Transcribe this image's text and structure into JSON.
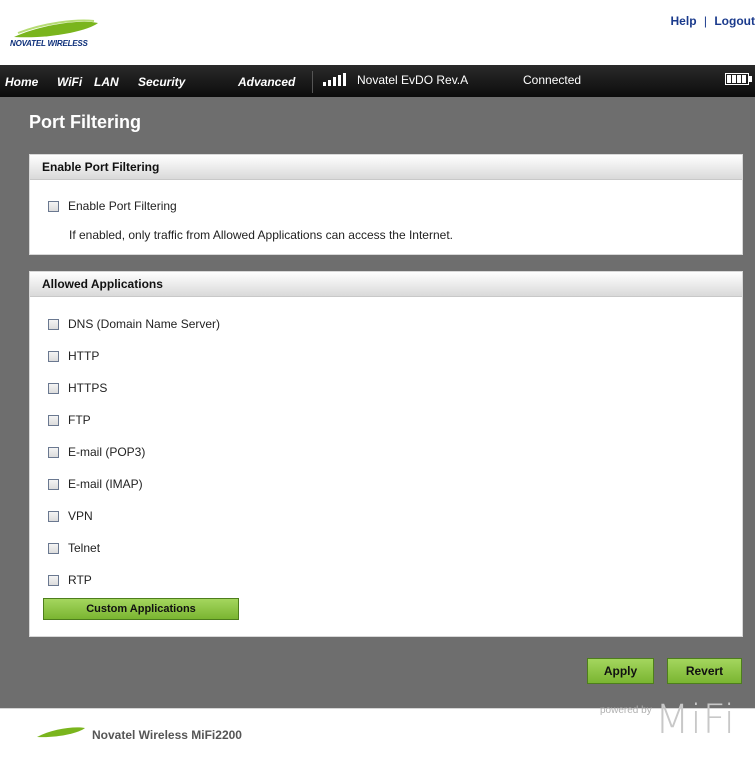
{
  "header": {
    "logo_text": "NOVATEL WIRELESS",
    "help_label": "Help",
    "separator": "|",
    "logout_label": "Logout"
  },
  "nav": {
    "tabs": [
      "Home",
      "WiFi",
      "LAN",
      "Security",
      "Advanced"
    ],
    "carrier": "Novatel EvDO Rev.A",
    "connection_status": "Connected",
    "signal_bars": 5,
    "battery_level": 1.0
  },
  "page": {
    "title": "Port Filtering"
  },
  "enable_section": {
    "heading": "Enable Port Filtering",
    "checkbox_label": "Enable Port Filtering",
    "checked": false,
    "note": "If enabled, only traffic from Allowed Applications can access the Internet."
  },
  "allowed_section": {
    "heading": "Allowed Applications",
    "apps": [
      {
        "label": "DNS (Domain Name Server)",
        "checked": false
      },
      {
        "label": "HTTP",
        "checked": false
      },
      {
        "label": "HTTPS",
        "checked": false
      },
      {
        "label": "FTP",
        "checked": false
      },
      {
        "label": "E-mail (POP3)",
        "checked": false
      },
      {
        "label": "E-mail (IMAP)",
        "checked": false
      },
      {
        "label": "VPN",
        "checked": false
      },
      {
        "label": "Telnet",
        "checked": false
      },
      {
        "label": "RTP",
        "checked": false
      }
    ],
    "custom_button_label": "Custom Applications"
  },
  "actions": {
    "apply_label": "Apply",
    "revert_label": "Revert"
  },
  "footer": {
    "product_name": "Novatel Wireless MiFi2200",
    "powered_by": "powered by",
    "brand": "MiFi"
  },
  "colors": {
    "nav_bg": "#111111",
    "content_bg": "#6e6e6e",
    "button_green": "#8cc63f",
    "brand_green": "#7ab51d",
    "brand_blue": "#0d2f7a"
  }
}
